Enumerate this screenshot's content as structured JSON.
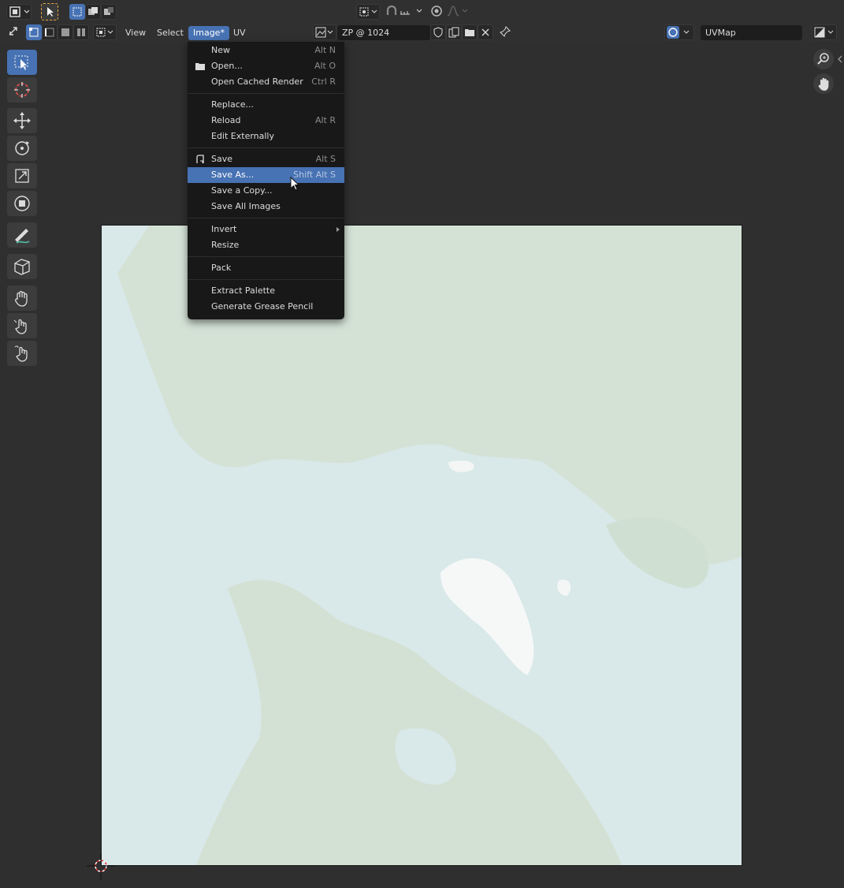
{
  "header": {
    "menus": [
      "View",
      "Select",
      "Image*",
      "UV"
    ],
    "image_name": "ZP @ 1024",
    "uv_map": "UVMap"
  },
  "image_menu": {
    "items": [
      {
        "label": "New",
        "shortcut": "Alt N"
      },
      {
        "label": "Open...",
        "shortcut": "Alt O",
        "icon": "folder-icon"
      },
      {
        "label": "Open Cached Render",
        "shortcut": "Ctrl R"
      },
      {
        "label": "Replace...",
        "shortcut": ""
      },
      {
        "label": "Reload",
        "shortcut": "Alt R"
      },
      {
        "label": "Edit Externally",
        "shortcut": ""
      },
      {
        "label": "Save",
        "shortcut": "Alt S",
        "icon": "save-icon"
      },
      {
        "label": "Save As...",
        "shortcut": "Shift Alt S",
        "highlighted": true
      },
      {
        "label": "Save a Copy...",
        "shortcut": ""
      },
      {
        "label": "Save All Images",
        "shortcut": ""
      },
      {
        "label": "Invert",
        "shortcut": "",
        "submenu": true
      },
      {
        "label": "Resize",
        "shortcut": ""
      },
      {
        "label": "Pack",
        "shortcut": ""
      },
      {
        "label": "Extract Palette",
        "shortcut": ""
      },
      {
        "label": "Generate Grease Pencil",
        "shortcut": ""
      }
    ]
  },
  "toolbar": {
    "tools": [
      "select-box-icon",
      "cursor-icon",
      "move-icon",
      "rotate-icon",
      "scale-icon",
      "transform-icon",
      "annotate-icon",
      "rip-region-icon",
      "grab-icon",
      "relax-icon",
      "pinch-icon"
    ]
  },
  "colors": {
    "accent": "#4772b3",
    "menu_bg": "#181818",
    "editor_bg": "#303030"
  }
}
